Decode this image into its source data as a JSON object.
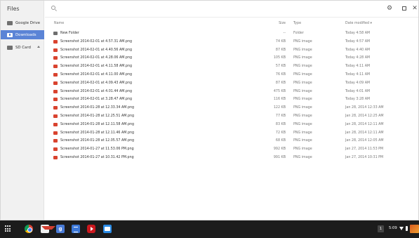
{
  "sidebar": {
    "title": "Files",
    "items": [
      {
        "label": "Google Drive",
        "icon": "google-drive-icon"
      },
      {
        "label": "Downloads",
        "icon": "downloads-folder-icon",
        "active": true
      },
      {
        "label": "SD Card",
        "icon": "sd-card-icon"
      }
    ]
  },
  "columns": {
    "name": "Name",
    "size": "Size",
    "type": "Type",
    "date": "Date modified ▾"
  },
  "files": [
    {
      "name": "New Folder",
      "size": "--",
      "type": "Folder",
      "date": "Today 4:58 AM",
      "kind": "folder"
    },
    {
      "name": "Screenshot 2014-02-01 at 4.57.31 AM.png",
      "size": "74 KB",
      "type": "PNG image",
      "date": "Today 4:57 AM",
      "kind": "png"
    },
    {
      "name": "Screenshot 2014-02-01 at 4.40.56 AM.png",
      "size": "87 KB",
      "type": "PNG image",
      "date": "Today 4:40 AM",
      "kind": "png"
    },
    {
      "name": "Screenshot 2014-02-01 at 4.28.06 AM.png",
      "size": "105 KB",
      "type": "PNG image",
      "date": "Today 4:28 AM",
      "kind": "png"
    },
    {
      "name": "Screenshot 2014-02-01 at 4.11.58 AM.png",
      "size": "57 KB",
      "type": "PNG image",
      "date": "Today 4:11 AM",
      "kind": "png"
    },
    {
      "name": "Screenshot 2014-02-01 at 4.11.00 AM.png",
      "size": "76 KB",
      "type": "PNG image",
      "date": "Today 4:11 AM",
      "kind": "png"
    },
    {
      "name": "Screenshot 2014-02-01 at 4.09.43 AM.png",
      "size": "87 KB",
      "type": "PNG image",
      "date": "Today 4:09 AM",
      "kind": "png"
    },
    {
      "name": "Screenshot 2014-02-01 at 4.01.44 AM.png",
      "size": "475 KB",
      "type": "PNG image",
      "date": "Today 4:01 AM",
      "kind": "png"
    },
    {
      "name": "Screenshot 2014-02-01 at 3.28.47 AM.png",
      "size": "116 KB",
      "type": "PNG image",
      "date": "Today 3:28 AM",
      "kind": "png"
    },
    {
      "name": "Screenshot 2014-01-28 at 12.33.34 AM.png",
      "size": "122 KB",
      "type": "PNG image",
      "date": "Jan 28, 2014 12:33 AM",
      "kind": "png"
    },
    {
      "name": "Screenshot 2014-01-28 at 12.25.51 AM.png",
      "size": "77 KB",
      "type": "PNG image",
      "date": "Jan 28, 2014 12:25 AM",
      "kind": "png"
    },
    {
      "name": "Screenshot 2014-01-28 at 12.11.58 AM.png",
      "size": "83 KB",
      "type": "PNG image",
      "date": "Jan 28, 2014 12:11 AM",
      "kind": "png"
    },
    {
      "name": "Screenshot 2014-01-28 at 12.11.46 AM.png",
      "size": "72 KB",
      "type": "PNG image",
      "date": "Jan 28, 2014 12:11 AM",
      "kind": "png"
    },
    {
      "name": "Screenshot 2014-01-28 at 12.05.57 AM.png",
      "size": "68 KB",
      "type": "PNG image",
      "date": "Jan 28, 2014 12:05 AM",
      "kind": "png"
    },
    {
      "name": "Screenshot 2014-01-27 at 11.53.06 PM.png",
      "size": "992 KB",
      "type": "PNG image",
      "date": "Jan 27, 2014 11:53 PM",
      "kind": "png"
    },
    {
      "name": "Screenshot 2014-01-27 at 10.31.42 PM.png",
      "size": "991 KB",
      "type": "PNG image",
      "date": "Jan 27, 2014 10:31 PM",
      "kind": "png"
    }
  ],
  "shelf": {
    "apps": [
      "chrome-icon",
      "gmail-icon",
      "google-plus-icon",
      "google-docs-icon",
      "youtube-icon",
      "files-app-icon"
    ],
    "gplus_glyph": "g",
    "notification_count": "1",
    "clock": "5:09"
  },
  "colors": {
    "accent": "#5b84d6",
    "png_icon": "#d9432f",
    "shelf_bg": "#1c1c1c"
  }
}
